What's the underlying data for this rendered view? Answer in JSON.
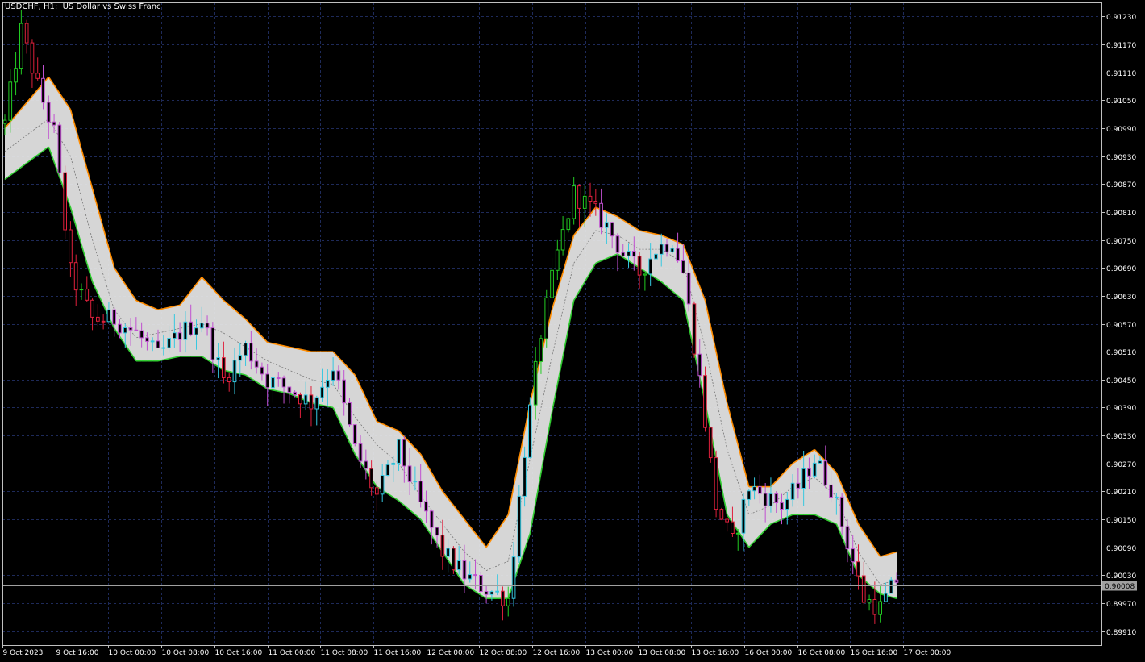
{
  "window": {
    "title": "USDCHF, H1:  US Dollar vs Swiss Franc"
  },
  "colors": {
    "background": "#000000",
    "grid": "#1e2a5a",
    "frame": "#c0c0c0",
    "bull_candle": "#22cc22",
    "bear_candle": "#e0203c",
    "band_fill": "#e6e6e6",
    "band_upper_rising": "#ff8c00",
    "band_lower_rising": "#32cd32",
    "bid_line": "#a0a0a0",
    "axis_text": "#ffffff",
    "price_tag_bg": "#a0a0a0",
    "price_tag_text": "#000000"
  },
  "chart_data": {
    "type": "candlestick",
    "symbol": "USDCHF",
    "timeframe": "H1",
    "description": "US Dollar vs Swiss Franc",
    "y_axis": {
      "min": 0.8988,
      "max": 0.9126,
      "ticks": [
        "0.91230",
        "0.91170",
        "0.91110",
        "0.91050",
        "0.90990",
        "0.90930",
        "0.90870",
        "0.90810",
        "0.90750",
        "0.90690",
        "0.90630",
        "0.90570",
        "0.90510",
        "0.90450",
        "0.90390",
        "0.90330",
        "0.90270",
        "0.90210",
        "0.90150",
        "0.90090",
        "0.90030",
        "0.89970",
        "0.89910"
      ]
    },
    "x_axis": {
      "labels": [
        "9 Oct 2023",
        "9 Oct 16:00",
        "10 Oct 00:00",
        "10 Oct 08:00",
        "10 Oct 16:00",
        "11 Oct 00:00",
        "11 Oct 08:00",
        "11 Oct 16:00",
        "12 Oct 00:00",
        "12 Oct 08:00",
        "12 Oct 16:00",
        "13 Oct 00:00",
        "13 Oct 08:00",
        "13 Oct 16:00",
        "16 Oct 00:00",
        "16 Oct 08:00",
        "16 Oct 16:00",
        "17 Oct 00:00"
      ]
    },
    "current_price": "0.90008",
    "grid": true,
    "price_path": [
      {
        "bar": 0,
        "close": 0.91
      },
      {
        "bar": 3,
        "close": 0.912
      },
      {
        "bar": 6,
        "close": 0.9108
      },
      {
        "bar": 9,
        "close": 0.9098
      },
      {
        "bar": 12,
        "close": 0.9068
      },
      {
        "bar": 16,
        "close": 0.9058
      },
      {
        "bar": 20,
        "close": 0.9058
      },
      {
        "bar": 24,
        "close": 0.9055
      },
      {
        "bar": 28,
        "close": 0.905
      },
      {
        "bar": 32,
        "close": 0.9055
      },
      {
        "bar": 36,
        "close": 0.9058
      },
      {
        "bar": 40,
        "close": 0.9045
      },
      {
        "bar": 44,
        "close": 0.9052
      },
      {
        "bar": 48,
        "close": 0.9045
      },
      {
        "bar": 52,
        "close": 0.9043
      },
      {
        "bar": 56,
        "close": 0.904
      },
      {
        "bar": 60,
        "close": 0.9048
      },
      {
        "bar": 64,
        "close": 0.903
      },
      {
        "bar": 68,
        "close": 0.902
      },
      {
        "bar": 72,
        "close": 0.903
      },
      {
        "bar": 76,
        "close": 0.9018
      },
      {
        "bar": 80,
        "close": 0.9008
      },
      {
        "bar": 84,
        "close": 0.9003
      },
      {
        "bar": 88,
        "close": 0.9
      },
      {
        "bar": 92,
        "close": 0.8998
      },
      {
        "bar": 95,
        "close": 0.903
      },
      {
        "bar": 98,
        "close": 0.9055
      },
      {
        "bar": 101,
        "close": 0.9072
      },
      {
        "bar": 104,
        "close": 0.9085
      },
      {
        "bar": 107,
        "close": 0.9082
      },
      {
        "bar": 110,
        "close": 0.9078
      },
      {
        "bar": 113,
        "close": 0.9072
      },
      {
        "bar": 116,
        "close": 0.9068
      },
      {
        "bar": 119,
        "close": 0.9073
      },
      {
        "bar": 122,
        "close": 0.9075
      },
      {
        "bar": 124,
        "close": 0.9068
      },
      {
        "bar": 127,
        "close": 0.9045
      },
      {
        "bar": 130,
        "close": 0.9018
      },
      {
        "bar": 133,
        "close": 0.901
      },
      {
        "bar": 136,
        "close": 0.9022
      },
      {
        "bar": 139,
        "close": 0.902
      },
      {
        "bar": 142,
        "close": 0.9018
      },
      {
        "bar": 145,
        "close": 0.9022
      },
      {
        "bar": 148,
        "close": 0.9028
      },
      {
        "bar": 151,
        "close": 0.9022
      },
      {
        "bar": 154,
        "close": 0.901
      },
      {
        "bar": 157,
        "close": 0.8998
      },
      {
        "bar": 160,
        "close": 0.8996
      },
      {
        "bar": 163,
        "close": 0.9002
      }
    ],
    "band_path": [
      {
        "bar": 0,
        "mid": 0.9094,
        "upper": 0.9099,
        "lower": 0.9088
      },
      {
        "bar": 8,
        "mid": 0.9101,
        "upper": 0.911,
        "lower": 0.9095
      },
      {
        "bar": 12,
        "mid": 0.9093,
        "upper": 0.9103,
        "lower": 0.9082
      },
      {
        "bar": 16,
        "mid": 0.9075,
        "upper": 0.9086,
        "lower": 0.9066
      },
      {
        "bar": 20,
        "mid": 0.906,
        "upper": 0.9069,
        "lower": 0.9056
      },
      {
        "bar": 24,
        "mid": 0.9054,
        "upper": 0.9062,
        "lower": 0.9049
      },
      {
        "bar": 28,
        "mid": 0.9055,
        "upper": 0.906,
        "lower": 0.9049
      },
      {
        "bar": 32,
        "mid": 0.9056,
        "upper": 0.9061,
        "lower": 0.905
      },
      {
        "bar": 36,
        "mid": 0.9057,
        "upper": 0.9067,
        "lower": 0.905
      },
      {
        "bar": 40,
        "mid": 0.9055,
        "upper": 0.9062,
        "lower": 0.9047
      },
      {
        "bar": 44,
        "mid": 0.9052,
        "upper": 0.9058,
        "lower": 0.9046
      },
      {
        "bar": 48,
        "mid": 0.9049,
        "upper": 0.9053,
        "lower": 0.9043
      },
      {
        "bar": 52,
        "mid": 0.9047,
        "upper": 0.9052,
        "lower": 0.9042
      },
      {
        "bar": 56,
        "mid": 0.9045,
        "upper": 0.9051,
        "lower": 0.904
      },
      {
        "bar": 60,
        "mid": 0.9044,
        "upper": 0.9051,
        "lower": 0.9039
      },
      {
        "bar": 64,
        "mid": 0.9037,
        "upper": 0.9046,
        "lower": 0.9029
      },
      {
        "bar": 68,
        "mid": 0.9031,
        "upper": 0.9036,
        "lower": 0.9022
      },
      {
        "bar": 72,
        "mid": 0.9027,
        "upper": 0.9034,
        "lower": 0.9019
      },
      {
        "bar": 76,
        "mid": 0.902,
        "upper": 0.9029,
        "lower": 0.9015
      },
      {
        "bar": 80,
        "mid": 0.9014,
        "upper": 0.9021,
        "lower": 0.9008
      },
      {
        "bar": 84,
        "mid": 0.9008,
        "upper": 0.9015,
        "lower": 0.9001
      },
      {
        "bar": 88,
        "mid": 0.9004,
        "upper": 0.9009,
        "lower": 0.8998
      },
      {
        "bar": 92,
        "mid": 0.9006,
        "upper": 0.9016,
        "lower": 0.8998
      },
      {
        "bar": 96,
        "mid": 0.9028,
        "upper": 0.904,
        "lower": 0.9012
      },
      {
        "bar": 100,
        "mid": 0.905,
        "upper": 0.906,
        "lower": 0.9038
      },
      {
        "bar": 104,
        "mid": 0.907,
        "upper": 0.9076,
        "lower": 0.9062
      },
      {
        "bar": 108,
        "mid": 0.9077,
        "upper": 0.9082,
        "lower": 0.907
      },
      {
        "bar": 112,
        "mid": 0.9076,
        "upper": 0.908,
        "lower": 0.9072
      },
      {
        "bar": 116,
        "mid": 0.9073,
        "upper": 0.9077,
        "lower": 0.9069
      },
      {
        "bar": 120,
        "mid": 0.9073,
        "upper": 0.9076,
        "lower": 0.9066
      },
      {
        "bar": 124,
        "mid": 0.907,
        "upper": 0.9074,
        "lower": 0.9062
      },
      {
        "bar": 128,
        "mid": 0.9052,
        "upper": 0.9062,
        "lower": 0.904
      },
      {
        "bar": 132,
        "mid": 0.903,
        "upper": 0.904,
        "lower": 0.9016
      },
      {
        "bar": 136,
        "mid": 0.9016,
        "upper": 0.9022,
        "lower": 0.9009
      },
      {
        "bar": 140,
        "mid": 0.9018,
        "upper": 0.9022,
        "lower": 0.9014
      },
      {
        "bar": 144,
        "mid": 0.9022,
        "upper": 0.9027,
        "lower": 0.9016
      },
      {
        "bar": 148,
        "mid": 0.9024,
        "upper": 0.903,
        "lower": 0.9016
      },
      {
        "bar": 152,
        "mid": 0.902,
        "upper": 0.9025,
        "lower": 0.9014
      },
      {
        "bar": 156,
        "mid": 0.9008,
        "upper": 0.9014,
        "lower": 0.9003
      },
      {
        "bar": 160,
        "mid": 0.9001,
        "upper": 0.9007,
        "lower": 0.8999
      },
      {
        "bar": 163,
        "mid": 0.9002,
        "upper": 0.9008,
        "lower": 0.8998
      }
    ]
  }
}
